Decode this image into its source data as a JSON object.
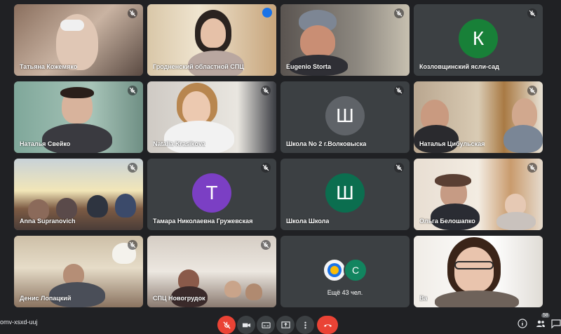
{
  "tiles": [
    {
      "name": "Татьяна Кожемяко",
      "type": "video"
    },
    {
      "name": "Гродненский областной СПЦ",
      "type": "video"
    },
    {
      "name": "Eugenio Storta",
      "type": "video"
    },
    {
      "name": "Козловщинский ясли-сад",
      "type": "avatar",
      "letter": "К",
      "color": "#188038"
    },
    {
      "name": "Наталья Свейко",
      "type": "video"
    },
    {
      "name": "Natalia Krasikova",
      "type": "video"
    },
    {
      "name": "Школа No 2 г.Волковыска",
      "type": "avatar",
      "letter": "Ш",
      "color": "#5f6368"
    },
    {
      "name": "Наталья Цибульская",
      "type": "video"
    },
    {
      "name": "Anna Supranovich",
      "type": "video"
    },
    {
      "name": "Тамара Николаевна Гружевская",
      "type": "avatar",
      "letter": "Т",
      "color": "#7b3fc4"
    },
    {
      "name": "Школа Школа",
      "type": "avatar",
      "letter": "Ш",
      "color": "#0b6e4f"
    },
    {
      "name": "Ольга Белошапко",
      "type": "video"
    },
    {
      "name": "Денис Лопацкий",
      "type": "video"
    },
    {
      "name": "СПЦ Новогрудок",
      "type": "video"
    },
    {
      "name": "",
      "type": "more",
      "letter": "С",
      "label": "Ещё 43 чел."
    },
    {
      "name": "Ва",
      "type": "video"
    }
  ],
  "meeting_code": "omv-xsxd-uuj",
  "participants_badge": "58",
  "colors": {
    "background": "#202124",
    "tile": "#3c4043",
    "end_call": "#ea4335",
    "accent": "#8ab4f8"
  }
}
